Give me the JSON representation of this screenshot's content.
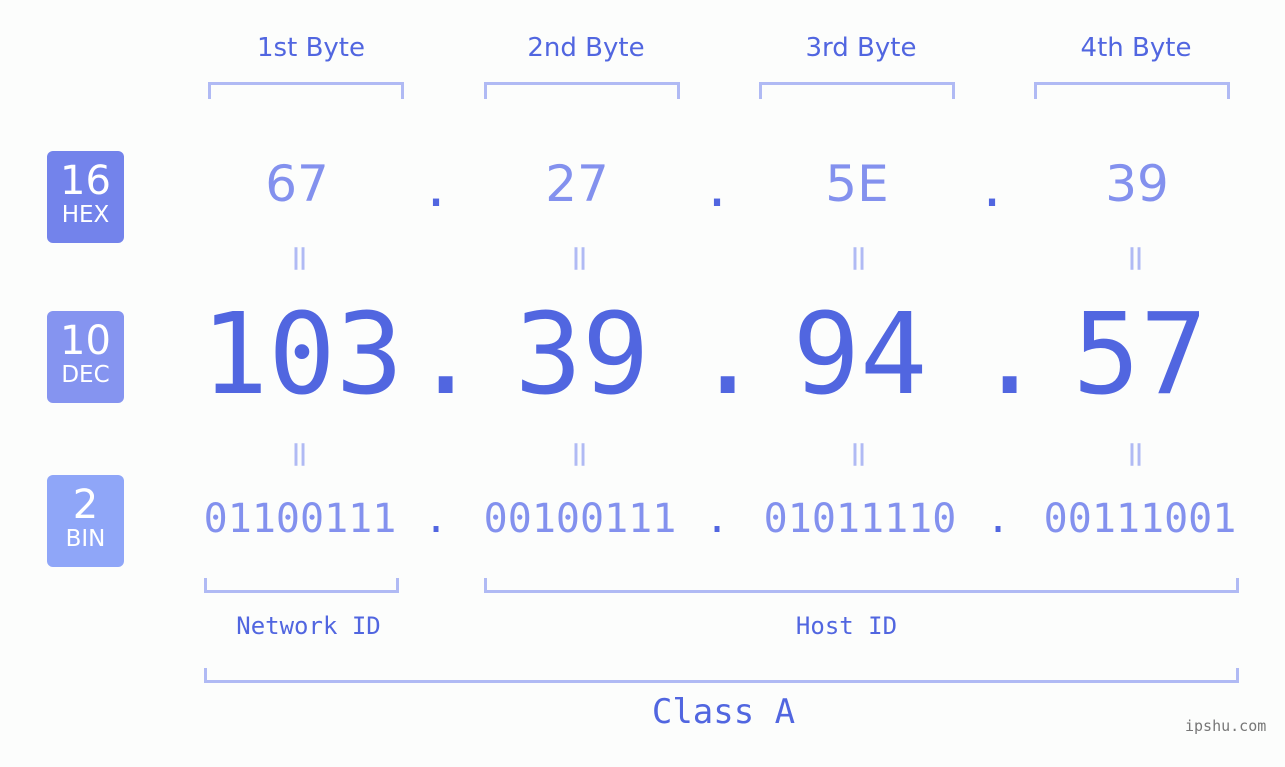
{
  "byte_headers": [
    "1st Byte",
    "2nd Byte",
    "3rd Byte",
    "4th Byte"
  ],
  "badges": [
    {
      "base": "16",
      "name": "HEX",
      "color": "#7383eb"
    },
    {
      "base": "10",
      "name": "DEC",
      "color": "#8594f0"
    },
    {
      "base": "2",
      "name": "BIN",
      "color": "#8fa6f8"
    }
  ],
  "hex": [
    "67",
    "27",
    "5E",
    "39"
  ],
  "dec": [
    "103",
    "39",
    "94",
    "57"
  ],
  "bin": [
    "01100111",
    "00100111",
    "01011110",
    "00111001"
  ],
  "separator": ".",
  "equals": "=",
  "network_id_label": "Network ID",
  "host_id_label": "Host ID",
  "class_label": "Class A",
  "credit": "ipshu.com",
  "colors": {
    "primary": "#5166e0",
    "light": "#8391ee",
    "bracket": "#b0baf4"
  }
}
